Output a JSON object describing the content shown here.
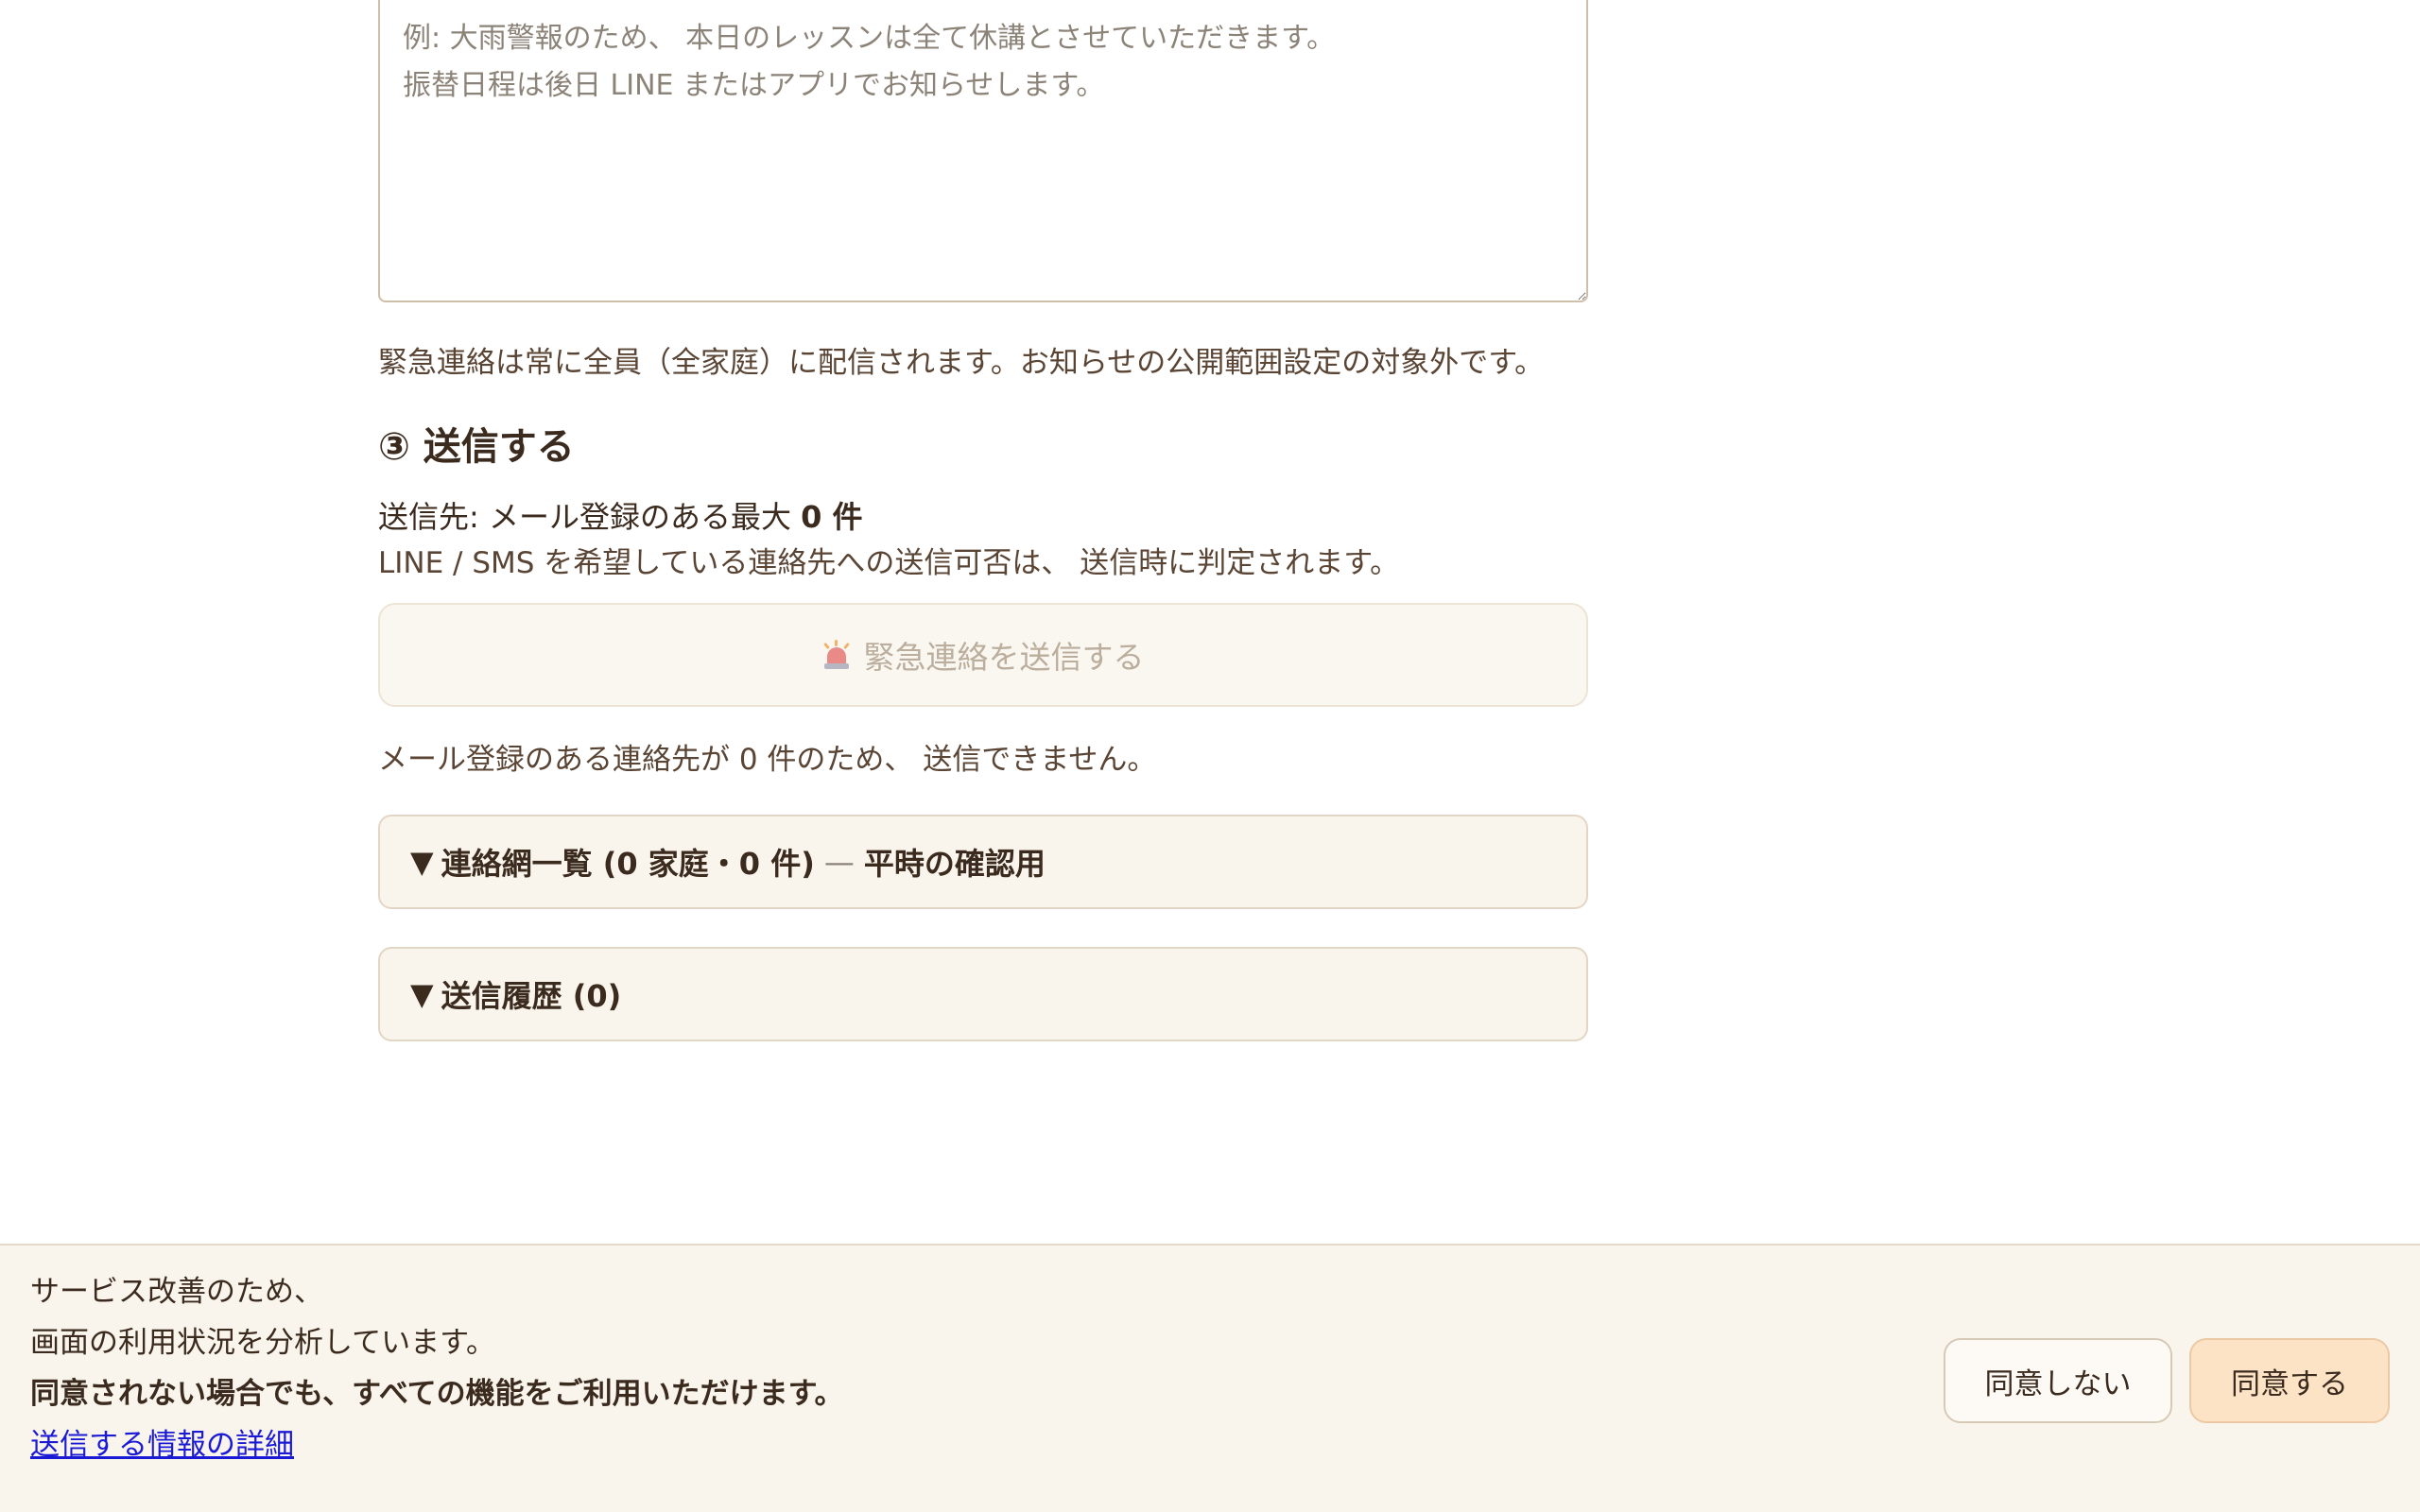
{
  "compose": {
    "message_placeholder": "例: 大雨警報のため、 本日のレッスンは全て休講とさせていただきます。\n振替日程は後日 LINE またはアプリでお知らせします。",
    "message_value": "",
    "audience_note": "緊急連絡は常に全員（全家庭）に配信されます。お知らせの公開範囲設定の対象外です。"
  },
  "send_section": {
    "title": "③ 送信する",
    "recipient_prefix": "送信先: メール登録のある最大 ",
    "recipient_count": "0 件",
    "channel_note": "LINE / SMS を希望している連絡先への送信可否は、 送信時に判定されます。",
    "send_button_label": "緊急連絡を送信する",
    "send_button_icon": "siren-icon",
    "disabled_reason": "メール登録のある連絡先が 0 件のため、 送信できません。"
  },
  "accordions": {
    "roster": {
      "marker": "▼",
      "label": "連絡網一覧 (0 家庭・0 件)",
      "separator": "—",
      "suffix": "平時の確認用"
    },
    "history": {
      "marker": "▼",
      "label": "送信履歴 (0)"
    }
  },
  "cookie_banner": {
    "line1": "サービス改善のため、",
    "line2": "画面の利用状況を分析しています。",
    "line3": "同意されない場合でも、すべての機能をご利用いただけます。",
    "details_link": "送信する情報の詳細",
    "decline_label": "同意しない",
    "accept_label": "同意する"
  },
  "colors": {
    "text": "#3b2a1e",
    "muted_text": "#5a4535",
    "panel_bg": "#faf5ec",
    "accept_bg": "#fde3c6",
    "link": "#1a1ad6"
  }
}
